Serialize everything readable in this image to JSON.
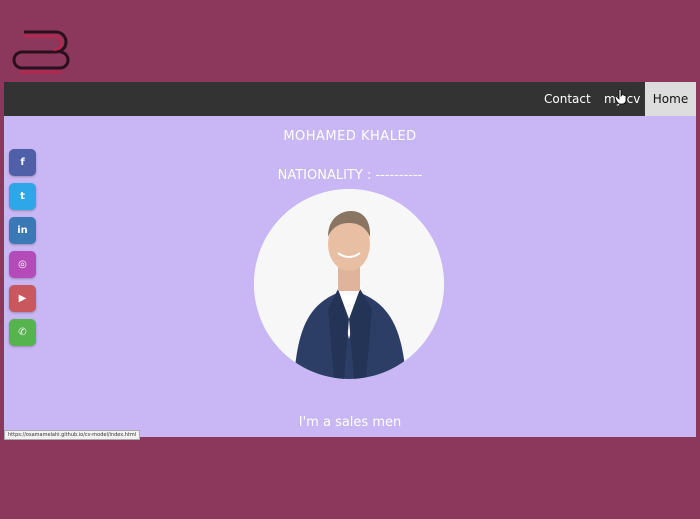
{
  "nav": {
    "contact": "Contact",
    "my_cv": "my cv",
    "home": "Home"
  },
  "profile": {
    "name": "MOHAMED KHALED",
    "nationality": "NATIONALITY : ----------",
    "tagline": "I'm a sales men"
  },
  "social": [
    {
      "icon": "facebook-icon",
      "glyph": "f",
      "color": "#4f5fa8"
    },
    {
      "icon": "twitter-icon",
      "glyph": "t",
      "color": "#2da7e8"
    },
    {
      "icon": "linkedin-icon",
      "glyph": "in",
      "color": "#3a79b6"
    },
    {
      "icon": "instagram-icon",
      "glyph": "◎",
      "color": "#b44bb8"
    },
    {
      "icon": "youtube-icon",
      "glyph": "▶",
      "color": "#c8585e"
    },
    {
      "icon": "whatsapp-icon",
      "glyph": "✆",
      "color": "#56b44f"
    }
  ],
  "status_bar": {
    "url": "https://osamamelahi.github.io/cv-model/index.html"
  },
  "colors": {
    "background": "#8b385c",
    "page": "#c8b7f4",
    "navbar": "#333333",
    "home_active": "#dddddd"
  }
}
